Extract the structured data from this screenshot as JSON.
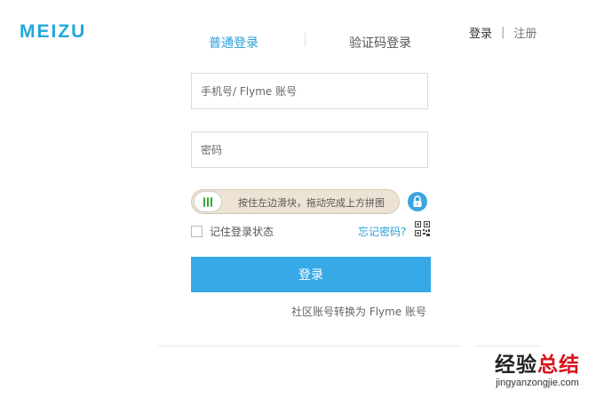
{
  "brand": {
    "logo_text": "MEIZU",
    "accent_color": "#1fa9d9"
  },
  "header": {
    "login_label": "登录",
    "separator": "|",
    "register_label": "注册"
  },
  "tabs": [
    {
      "label": "普通登录",
      "active": true
    },
    {
      "label": "验证码登录",
      "active": false
    }
  ],
  "form": {
    "account_placeholder": "手机号/ Flyme 账号",
    "account_value": "",
    "password_placeholder": "密码",
    "password_value": "",
    "slider_text": "按住左边滑块，拖动完成上方拼图",
    "remember_label": "记住登录状态",
    "remember_checked": false,
    "forgot_label": "忘记密码?",
    "submit_label": "登录",
    "submit_color": "#37a9e6",
    "convert_label": "社区账号转换为 Flyme 账号"
  },
  "icons": {
    "lock": "lock-icon",
    "qr": "qr-code-icon",
    "slider_handle": "slider-grip-icon"
  },
  "watermark": {
    "text_part1": "经验",
    "text_part2": "总结",
    "url": "jingyanzongjie.com"
  }
}
